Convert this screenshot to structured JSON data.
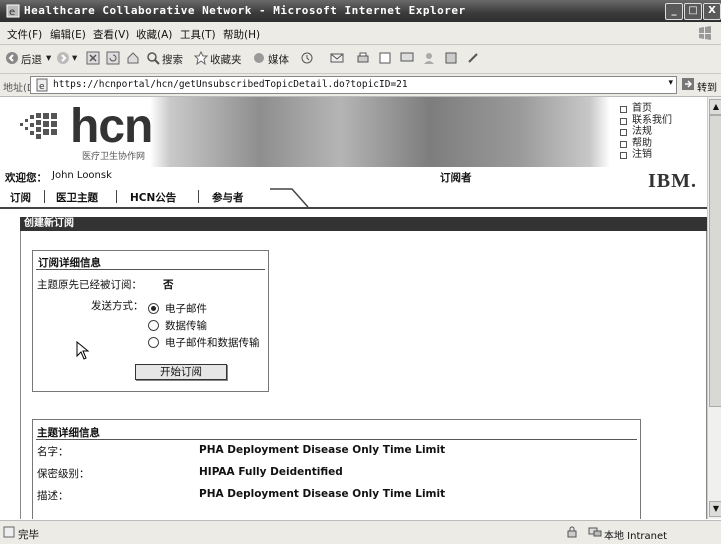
{
  "window": {
    "title": "Healthcare Collaborative Network - Microsoft Internet Explorer",
    "buttons": {
      "minimize": "_",
      "maximize": "□",
      "close": "X"
    }
  },
  "menubar": {
    "items": [
      "文件(F)",
      "编辑(E)",
      "查看(V)",
      "收藏(A)",
      "工具(T)",
      "帮助(H)"
    ]
  },
  "toolbar": {
    "back": "后退",
    "search": "搜索",
    "favorites": "收藏夹",
    "media": "媒体"
  },
  "addressbar": {
    "label": "地址(D)",
    "url": "https://hcnportal/hcn/getUnsubscribedTopicDetail.do?topicID=21",
    "go": "转到"
  },
  "page": {
    "logo": {
      "text": "hcn",
      "subtitle": "医疗卫生协作网"
    },
    "toplinks": [
      "首页",
      "联系我们",
      "法规",
      "帮助",
      "注销"
    ],
    "welcome_label": "欢迎您：",
    "user_name": "John Loonsk",
    "role": "订阅者",
    "ibm": "IBM.",
    "tabs": [
      "订阅",
      "医卫主题",
      "HCN公告",
      "参与者"
    ],
    "section_title": "创建新订阅",
    "subscription": {
      "title": "订阅详细信息",
      "already_label": "主题原先已经被订阅：",
      "already_value": "否",
      "method_label": "发送方式：",
      "options": [
        "电子邮件",
        "数据传输",
        "电子邮件和数据传输"
      ],
      "selected_index": 0,
      "start_button": "开始订阅"
    },
    "topic": {
      "title": "主题详细信息",
      "rows": [
        {
          "label": "名字：",
          "value": "PHA Deployment Disease Only Time Limit"
        },
        {
          "label": "保密级别：",
          "value": "HIPAA Fully Deidentified"
        },
        {
          "label": "描述：",
          "value": "PHA Deployment Disease Only Time Limit"
        }
      ]
    }
  },
  "statusbar": {
    "status": "完毕",
    "zone": "本地 Intranet"
  }
}
